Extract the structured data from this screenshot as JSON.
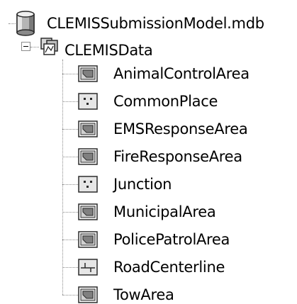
{
  "tree": {
    "root": {
      "label": "CLEMISSubmissionModel.mdb",
      "icon": "database-icon"
    },
    "dataset": {
      "label": "CLEMISData",
      "icon": "feature-dataset-icon",
      "expanded": true
    },
    "items": [
      {
        "label": "AnimalControlArea",
        "icon": "polygon-featureclass-icon"
      },
      {
        "label": "CommonPlace",
        "icon": "point-featureclass-icon"
      },
      {
        "label": "EMSResponseArea",
        "icon": "polygon-featureclass-icon"
      },
      {
        "label": "FireResponseArea",
        "icon": "polygon-featureclass-icon"
      },
      {
        "label": "Junction",
        "icon": "point-featureclass-icon"
      },
      {
        "label": "MunicipalArea",
        "icon": "polygon-featureclass-icon"
      },
      {
        "label": "PolicePatrolArea",
        "icon": "polygon-featureclass-icon"
      },
      {
        "label": "RoadCenterline",
        "icon": "line-featureclass-icon"
      },
      {
        "label": "TowArea",
        "icon": "polygon-featureclass-icon"
      }
    ]
  }
}
